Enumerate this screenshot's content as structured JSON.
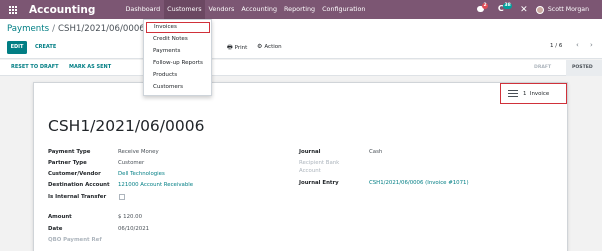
{
  "navbar": {
    "app_title": "Accounting",
    "menu": [
      "Dashboard",
      "Customers",
      "Vendors",
      "Accounting",
      "Reporting",
      "Configuration"
    ],
    "messages_badge": "2",
    "activities_badge": "38",
    "user_name": "Scott Morgan",
    "bg_color": "#7c5673"
  },
  "breadcrumb": {
    "parent": "Payments",
    "separator": "/",
    "current": "CSH1/2021/06/0006"
  },
  "control": {
    "edit_label": "EDIT",
    "create_label": "CREATE",
    "print_label": "Print",
    "action_label": "Action",
    "pager": "1 / 6"
  },
  "customers_menu": [
    "Invoices",
    "Credit Notes",
    "Payments",
    "Follow-up Reports",
    "Products",
    "Customers"
  ],
  "statusbar": {
    "reset_label": "RESET TO DRAFT",
    "mark_sent_label": "MARK AS SENT",
    "stages": [
      "DRAFT",
      "POSTED"
    ]
  },
  "smart_button": {
    "count": "1",
    "label": "Invoice"
  },
  "record": {
    "title": "CSH1/2021/06/0006",
    "left_fields": [
      {
        "label": "Payment Type",
        "value": "Receive Money"
      },
      {
        "label": "Partner Type",
        "value": "Customer"
      },
      {
        "label": "Customer/Vendor",
        "value": "Dell Technologies"
      },
      {
        "label": "Destination Account",
        "value": "121000 Account Receivable"
      },
      {
        "label": "Is Internal Transfer",
        "value": ""
      }
    ],
    "right_fields": [
      {
        "label": "Journal",
        "value": "Cash"
      },
      {
        "label": "Recipient Bank Account",
        "value": ""
      },
      {
        "label": "Journal Entry",
        "value": "CSH1/2021/06/0006 (Invoice #1071)"
      }
    ],
    "amount": {
      "label": "Amount",
      "value": "$ 120.00"
    },
    "date": {
      "label": "Date",
      "value": "06/10/2021"
    },
    "qbo_ref": {
      "label": "QBO Payment Ref"
    }
  },
  "colors": {
    "accent": "#017e84",
    "highlight_border": "#d0313a"
  }
}
